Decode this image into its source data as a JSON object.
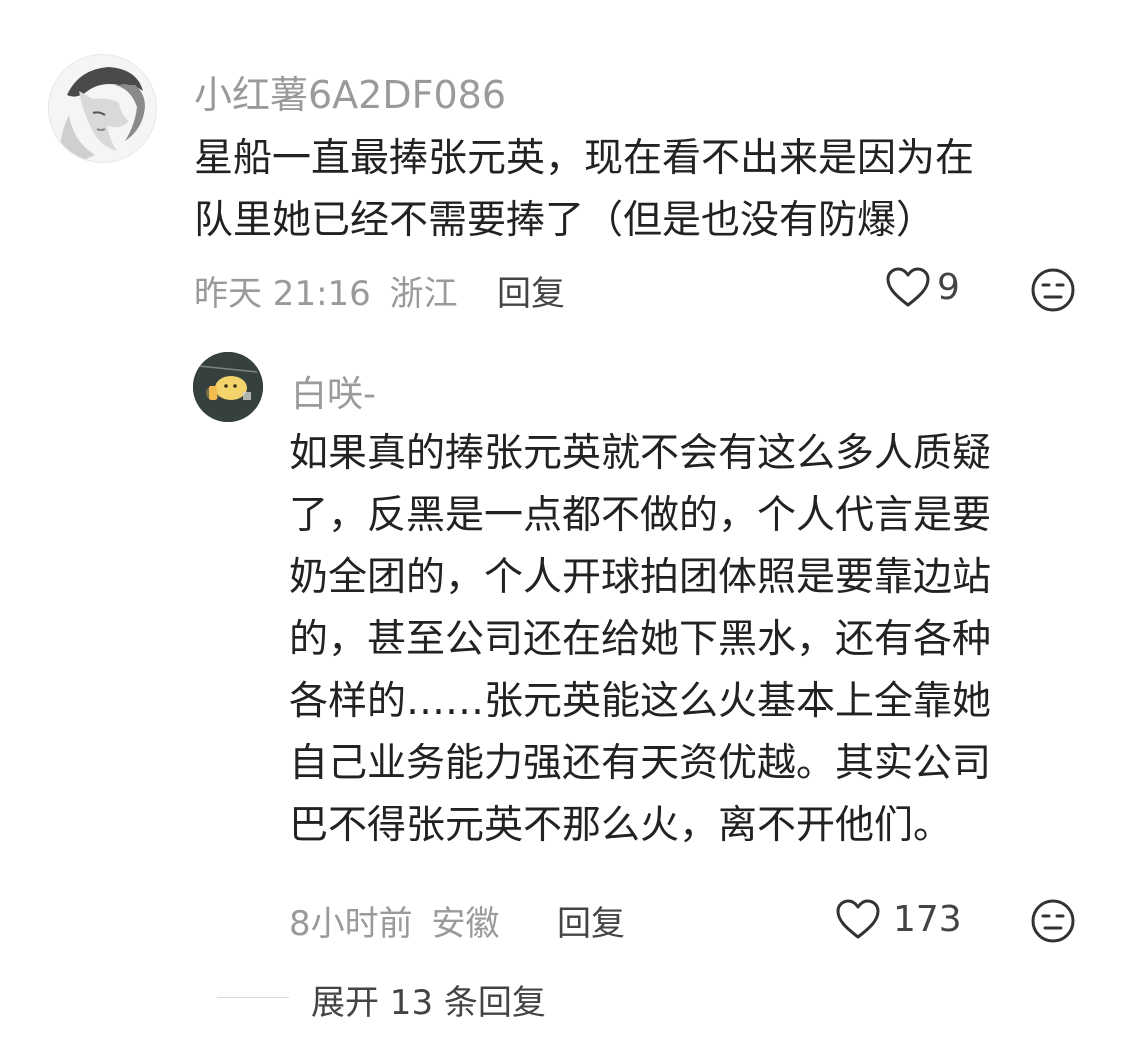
{
  "comment": {
    "username": "小红薯6A2DF086",
    "text_lines": [
      "星船一直最捧张元英，现在看不出来是因为在",
      "队里她已经不需要捧了（但是也没有防爆）"
    ],
    "time": "昨天 21:16",
    "location": "浙江",
    "reply_label": "回复",
    "likes": "9",
    "like_icon": "heart-outline-icon",
    "dislike_icon": "neutral-face-icon"
  },
  "reply": {
    "username": "白咲-",
    "text_lines": [
      "如果真的捧张元英就不会有这么多人质疑",
      "了，反黑是一点都不做的，个人代言是要",
      "奶全团的，个人开球拍团体照是要靠边站",
      "的，甚至公司还在给她下黑水，还有各种",
      "各样的……张元英能这么火基本上全靠她",
      "自己业务能力强还有天资优越。其实公司",
      "巴不得张元英不那么火，离不开他们。"
    ],
    "time": "8小时前",
    "location": "安徽",
    "reply_label": "回复",
    "likes": "173",
    "like_icon": "heart-outline-icon",
    "dislike_icon": "neutral-face-icon"
  },
  "expand_label": "展开 13 条回复"
}
